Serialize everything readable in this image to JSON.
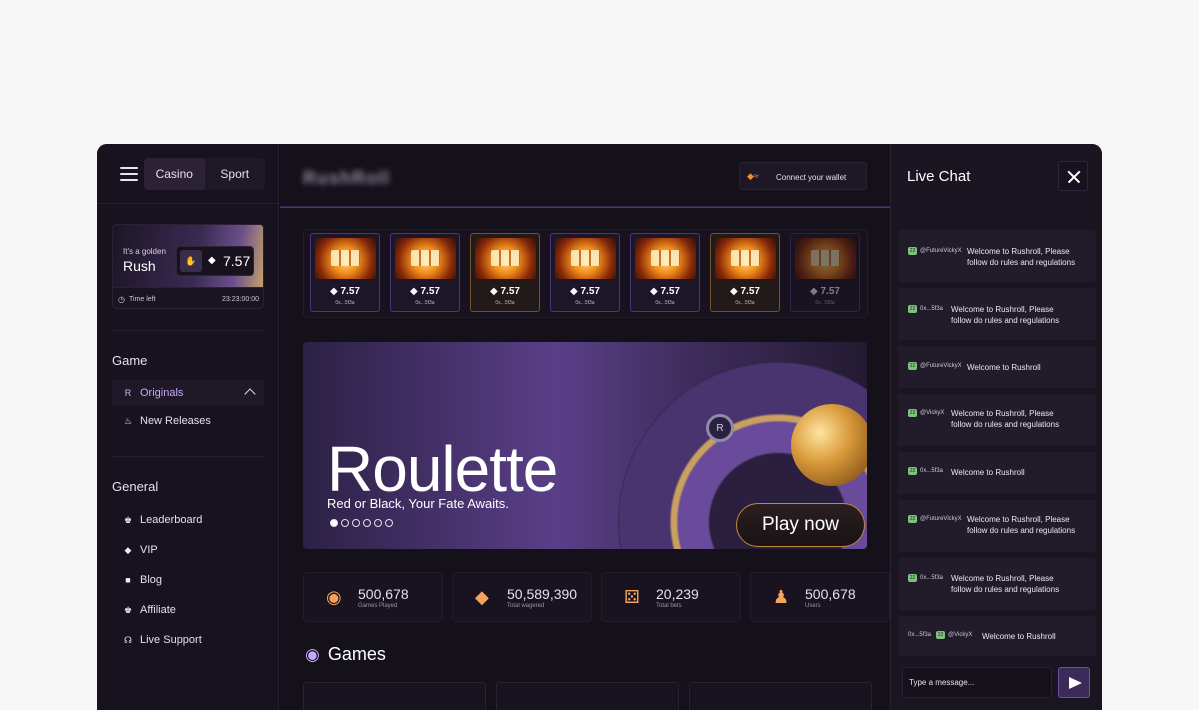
{
  "sidebar": {
    "tabs": [
      "Casino",
      "Sport"
    ],
    "promo": {
      "small_text": "It's a golden",
      "big_text": "Rush",
      "value": "7.57",
      "time_label": "Time left",
      "time_value": "23:23:00:00"
    },
    "game_section": "Game",
    "game_items": [
      {
        "label": "Originals",
        "icon": "originals-icon"
      },
      {
        "label": "New Releases",
        "icon": "fire-icon"
      }
    ],
    "general_section": "General",
    "general_items": [
      {
        "label": "Leaderboard",
        "icon": "leaderboard-icon"
      },
      {
        "label": "VIP",
        "icon": "diamond-icon"
      },
      {
        "label": "Blog",
        "icon": "blog-icon"
      },
      {
        "label": "Affiliate",
        "icon": "affiliate-icon"
      },
      {
        "label": "Live Support",
        "icon": "headset-icon"
      }
    ]
  },
  "header": {
    "logo": "RushRoll",
    "wallet_button": "Connect your wallet"
  },
  "recent_wins": [
    {
      "value": "7.57",
      "addr": "0x...5f3a"
    },
    {
      "value": "7.57",
      "addr": "0x...5f3a"
    },
    {
      "value": "7.57",
      "addr": "0x...5f3a"
    },
    {
      "value": "7.57",
      "addr": "0x...5f3a"
    },
    {
      "value": "7.57",
      "addr": "0x...5f3a"
    },
    {
      "value": "7.57",
      "addr": "0x...5f3a"
    },
    {
      "value": "7.57",
      "addr": "0x...5f3a"
    }
  ],
  "hero": {
    "title": "Roulette",
    "subtitle": "Red or Black, Your Fate Awaits.",
    "play_button": "Play now",
    "slides": 6,
    "active_slide": 0
  },
  "stats": [
    {
      "value": "500,678",
      "label": "Games Played",
      "icon": "gamepad-icon"
    },
    {
      "value": "50,589,390",
      "label": "Total wagered",
      "icon": "diamond-icon"
    },
    {
      "value": "20,239",
      "label": "Total bets",
      "icon": "dice-icon"
    },
    {
      "value": "500,678",
      "label": "Users",
      "icon": "users-icon"
    }
  ],
  "games_title": "Games",
  "chat": {
    "title": "Live Chat",
    "messages": [
      {
        "user": "@FutureVickyX",
        "text": "Welcome to Rushroll, Please follow do rules and regulations"
      },
      {
        "user": "0x...5f3a",
        "text": "Welcome to Rushroll, Please follow do rules and regulations"
      },
      {
        "user": "@FutureVickyX",
        "text": "Welcome to Rushroll"
      },
      {
        "user": "@VickyX",
        "text": "Welcome to Rushroll, Please follow do rules and regulations"
      },
      {
        "user": "0x...5f3a",
        "text": "Welcome to Rushroll"
      },
      {
        "user": "@FutureVickyX",
        "text": "Welcome to Rushroll, Please follow do rules and regulations"
      },
      {
        "user": "0x...5f3a",
        "text": "Welcome to Rushroll, Please follow do rules and regulations"
      },
      {
        "user": "0x...5f3a",
        "user2": "@VickyX",
        "text": "Welcome to Rushroll"
      }
    ],
    "input_placeholder": "Type a message..."
  }
}
